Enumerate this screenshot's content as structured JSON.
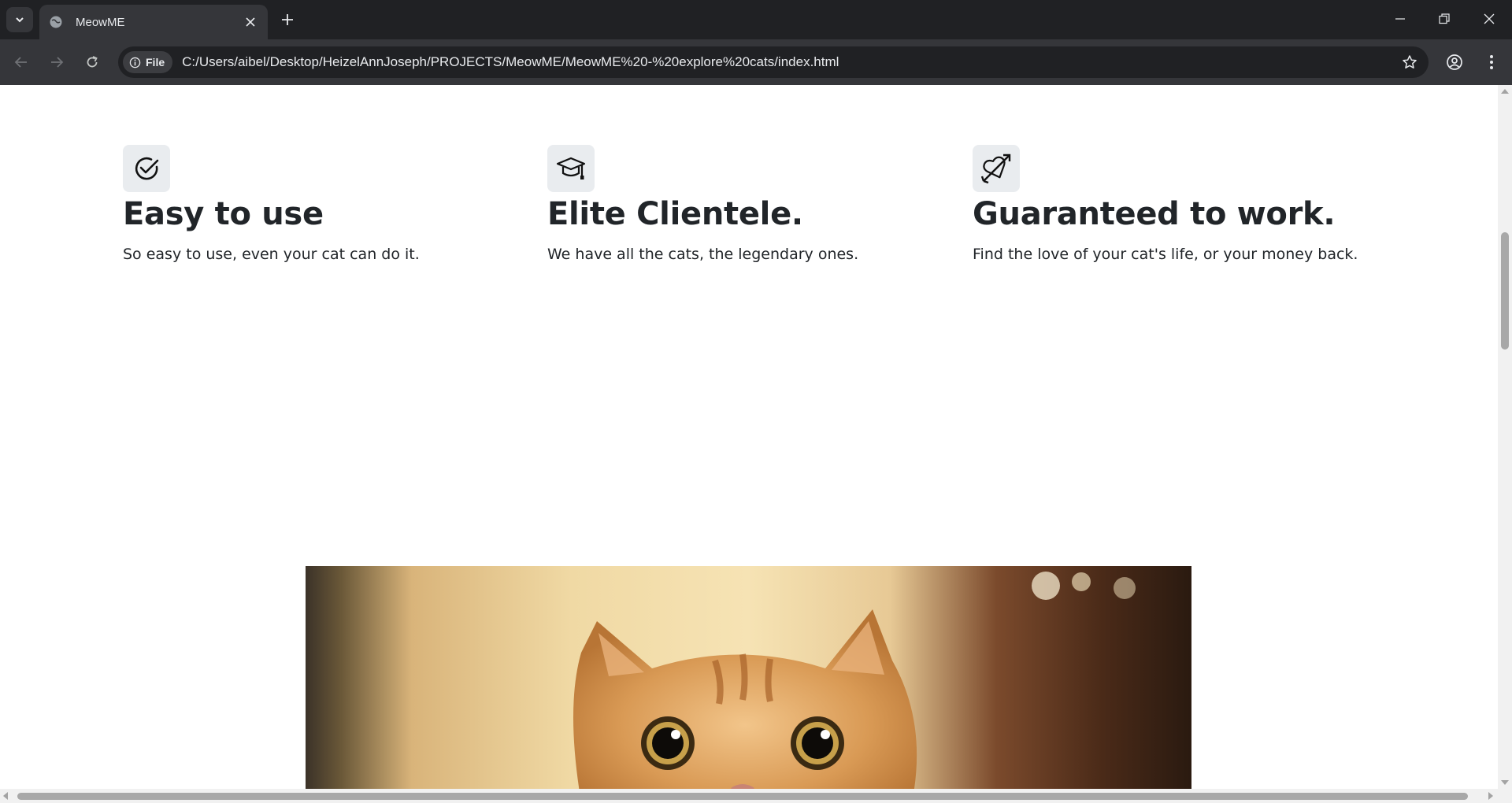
{
  "browser": {
    "tab_title": "MeowME",
    "address_chip": "File",
    "url": "C:/Users/aibel/Desktop/HeizelAnnJoseph/PROJECTS/MeowME/MeowME%20-%20explore%20cats/index.html"
  },
  "features": [
    {
      "icon": "check-circle-icon",
      "heading": "Easy to use",
      "text": "So easy to use, even your cat can do it."
    },
    {
      "icon": "graduation-cap-icon",
      "heading": "Elite Clientele.",
      "text": "We have all the cats, the legendary ones."
    },
    {
      "icon": "heart-arrow-icon",
      "heading": "Guaranteed to work.",
      "text": "Find the love of your cat's life, or your money back."
    }
  ],
  "colors": {
    "page_bg": "#ffffff",
    "icon_tile": "#e9ecef",
    "text": "#212529",
    "chrome_dark": "#202124",
    "chrome_toolbar": "#35363a"
  }
}
